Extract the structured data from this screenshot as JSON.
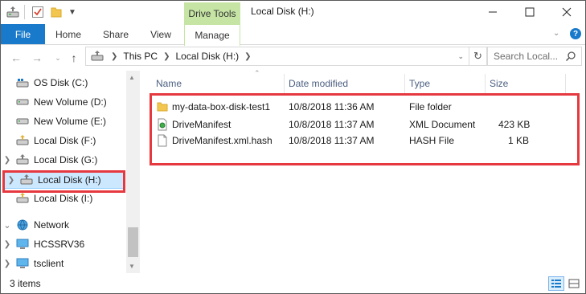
{
  "window": {
    "title": "Local Disk (H:)",
    "minimize_icon": "minimize-icon",
    "maximize_icon": "maximize-icon",
    "close_icon": "close-icon"
  },
  "ribbon": {
    "contextual_group": "Drive Tools",
    "tabs": [
      "File",
      "Home",
      "Share",
      "View",
      "Manage"
    ],
    "accent": "#1979ca",
    "contextual_color": "#c6e5a4"
  },
  "address": {
    "crumbs": [
      "This PC",
      "Local Disk (H:)"
    ],
    "search_placeholder": "Search Local..."
  },
  "nav": {
    "items": [
      {
        "label": "OS Disk (C:)",
        "icon": "os-drive-icon"
      },
      {
        "label": "New Volume (D:)",
        "icon": "drive-icon"
      },
      {
        "label": "New Volume (E:)",
        "icon": "drive-icon"
      },
      {
        "label": "Local Disk (F:)",
        "icon": "shared-drive-icon"
      },
      {
        "label": "Local Disk (G:)",
        "icon": "shared-drive-icon"
      },
      {
        "label": "Local Disk (H:)",
        "icon": "shared-drive-icon",
        "selected": true
      },
      {
        "label": "Local Disk (I:)",
        "icon": "shared-drive-icon"
      },
      {
        "label": "Network",
        "icon": "network-icon"
      },
      {
        "label": "HCSSRV36",
        "icon": "computer-icon"
      },
      {
        "label": "tsclient",
        "icon": "computer-icon"
      }
    ]
  },
  "columns": [
    "Name",
    "Date modified",
    "Type",
    "Size"
  ],
  "files": [
    {
      "name": "my-data-box-disk-test1",
      "date": "10/8/2018 11:36 AM",
      "type": "File folder",
      "size": "",
      "icon": "folder-icon"
    },
    {
      "name": "DriveManifest",
      "date": "10/8/2018 11:37 AM",
      "type": "XML Document",
      "size": "423 KB",
      "icon": "xml-file-icon"
    },
    {
      "name": "DriveManifest.xml.hash",
      "date": "10/8/2018 11:37 AM",
      "type": "HASH File",
      "size": "1 KB",
      "icon": "file-icon"
    }
  ],
  "status": {
    "item_count": "3 items"
  },
  "highlight_color": "#e5393f"
}
